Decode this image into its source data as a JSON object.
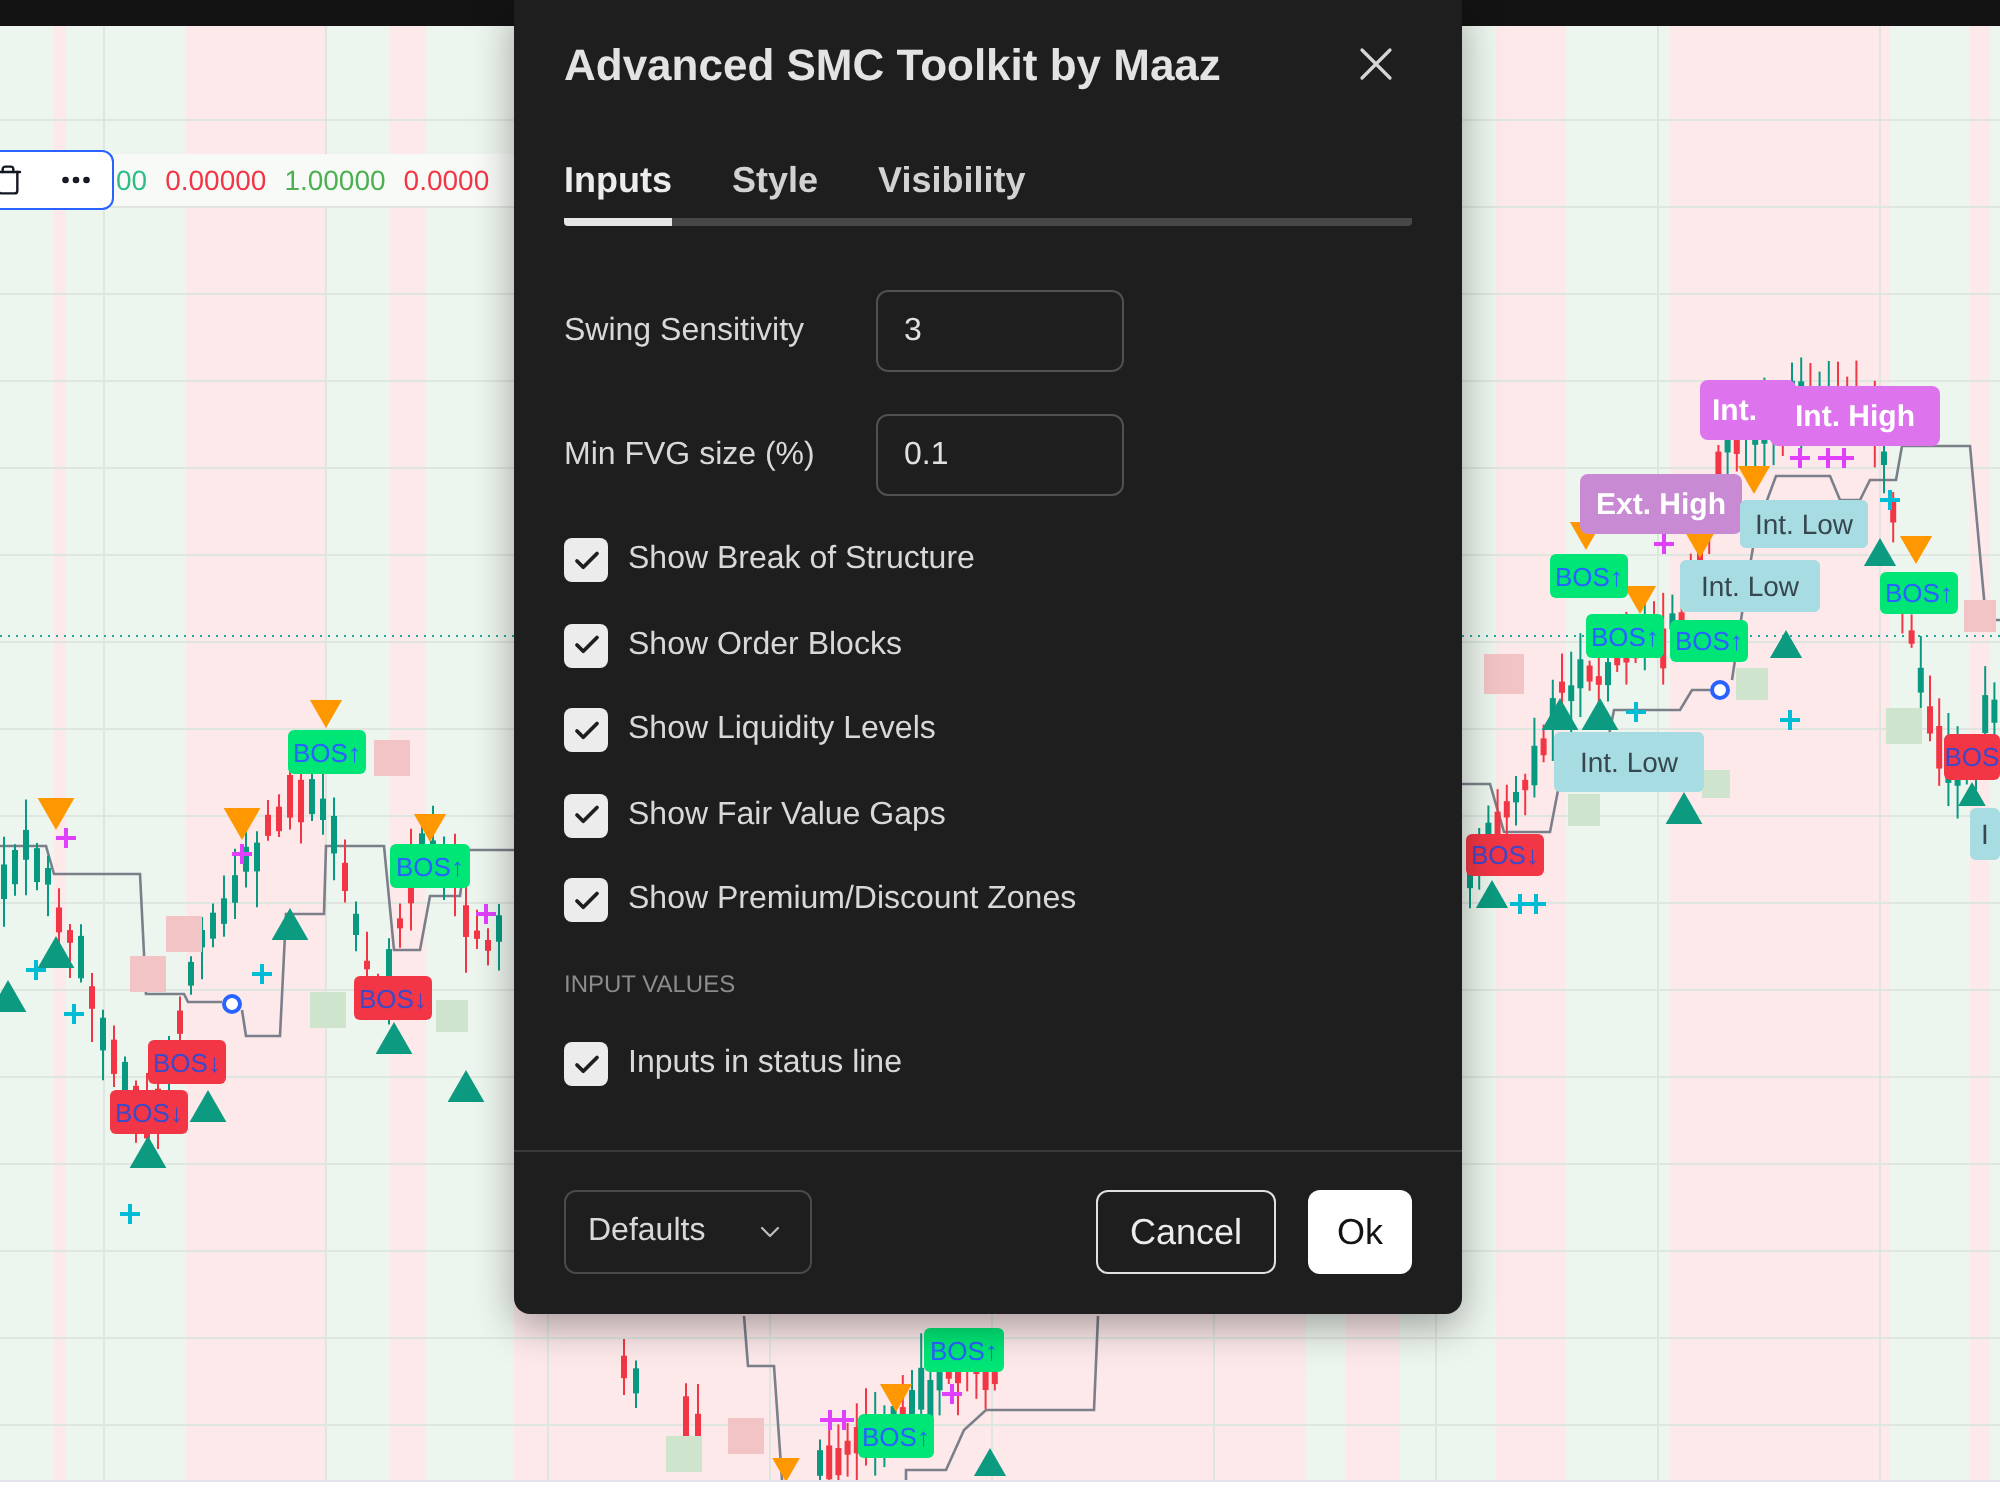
{
  "status_line": {
    "values": [
      {
        "text": "00",
        "color": "#2ebd85"
      },
      {
        "text": "0.00000",
        "color": "#f23645"
      },
      {
        "text": "1.00000",
        "color": "#4caf50"
      },
      {
        "text": "0.0000",
        "color": "#f23645"
      }
    ]
  },
  "chart": {
    "labels": [
      {
        "kind": "bos_up",
        "text": "BOS↑"
      },
      {
        "kind": "bos_up",
        "text": "BOS↑"
      },
      {
        "kind": "bos_down",
        "text": "BOS↓"
      },
      {
        "kind": "bos_down",
        "text": "BOS↓"
      },
      {
        "kind": "bos_down",
        "text": "BOS↓"
      },
      {
        "kind": "int_high",
        "text": "Int."
      },
      {
        "kind": "int_high",
        "text": "Int. High"
      },
      {
        "kind": "ext_high",
        "text": "Ext. High"
      },
      {
        "kind": "int_low",
        "text": "Int. Low"
      },
      {
        "kind": "bos_up",
        "text": "BOS↑"
      },
      {
        "kind": "int_low",
        "text": "Int. Low"
      },
      {
        "kind": "bos_up",
        "text": "BOS↑"
      },
      {
        "kind": "bos_up",
        "text": "BOS↑"
      },
      {
        "kind": "bos_up",
        "text": "BOS↑"
      },
      {
        "kind": "int_low",
        "text": "Int. Low"
      },
      {
        "kind": "bos_down",
        "text": "BOS"
      },
      {
        "kind": "int_low",
        "text": "I"
      },
      {
        "kind": "bos_down",
        "text": "BOS↓"
      },
      {
        "kind": "bos_up",
        "text": "BOS↑"
      },
      {
        "kind": "bos_up",
        "text": "BOS↑"
      }
    ]
  },
  "dialog": {
    "title": "Advanced SMC Toolkit by Maaz",
    "tabs": [
      {
        "label": "Inputs",
        "selected": true
      },
      {
        "label": "Style",
        "selected": false
      },
      {
        "label": "Visibility",
        "selected": false
      }
    ],
    "fields": [
      {
        "label": "Swing Sensitivity",
        "value": "3"
      },
      {
        "label": "Min FVG size (%)",
        "value": "0.1"
      }
    ],
    "checkboxes": [
      {
        "label": "Show Break of Structure",
        "checked": true
      },
      {
        "label": "Show Order Blocks",
        "checked": true
      },
      {
        "label": "Show Liquidity Levels",
        "checked": true
      },
      {
        "label": "Show Fair Value Gaps",
        "checked": true
      },
      {
        "label": "Show Premium/Discount Zones",
        "checked": true
      }
    ],
    "input_values": {
      "heading": "INPUT VALUES",
      "checkboxes": [
        {
          "label": "Inputs in status line",
          "checked": true
        }
      ]
    },
    "footer": {
      "preset": "Defaults",
      "cancel": "Cancel",
      "ok": "Ok"
    }
  }
}
